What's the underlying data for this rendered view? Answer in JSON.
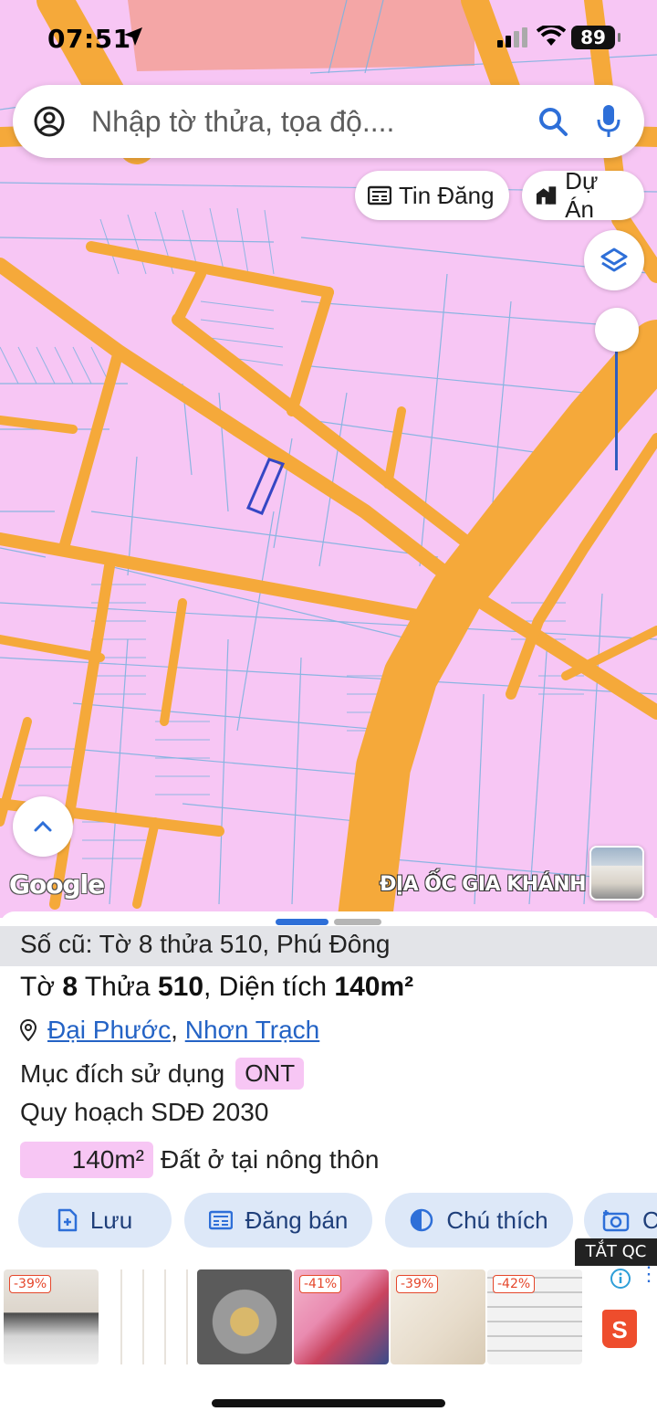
{
  "status_bar": {
    "time": "07:51",
    "battery": "89"
  },
  "search": {
    "placeholder": "Nhập tờ thửa, tọa độ...."
  },
  "chips": {
    "tin_dang": "Tin Đăng",
    "du_an": "Dự Án"
  },
  "map": {
    "attribution": "Google",
    "watermark": "ĐỊA ỐC GIA KHÁNH",
    "colors": {
      "land": "#f7c6f4",
      "road": "#f5a93a",
      "parcel_line": "#7fb3e0",
      "highlight": "#3547c4",
      "commercial": "#f4a6a6"
    }
  },
  "parcel": {
    "old_info": "Số cũ: Tờ 8 thửa 510, Phú Đông",
    "title_prefix_to": "Tờ",
    "sheet": "8",
    "title_thua": "Thửa",
    "plot": "510",
    "title_area_label": ", Diện tích",
    "area": "140m²",
    "ward": "Đại Phước",
    "district": "Nhơn Trạch",
    "purpose_label": "Mục đích sử dụng",
    "purpose_code": "ONT",
    "plan_label": "Quy hoạch SDĐ 2030",
    "plan_area": "140m²",
    "plan_desc": "Đất ở tại nông thôn"
  },
  "actions": {
    "save": "Lưu",
    "post": "Đăng bán",
    "legend": "Chú thích",
    "capture": "C"
  },
  "ads": {
    "close_label": "TẮT QC",
    "items": [
      {
        "discount": "-39%"
      },
      {
        "discount": ""
      },
      {
        "discount": ""
      },
      {
        "discount": "-41%"
      },
      {
        "discount": "-39%"
      },
      {
        "discount": "-42%"
      }
    ],
    "shop_icon": "S"
  }
}
